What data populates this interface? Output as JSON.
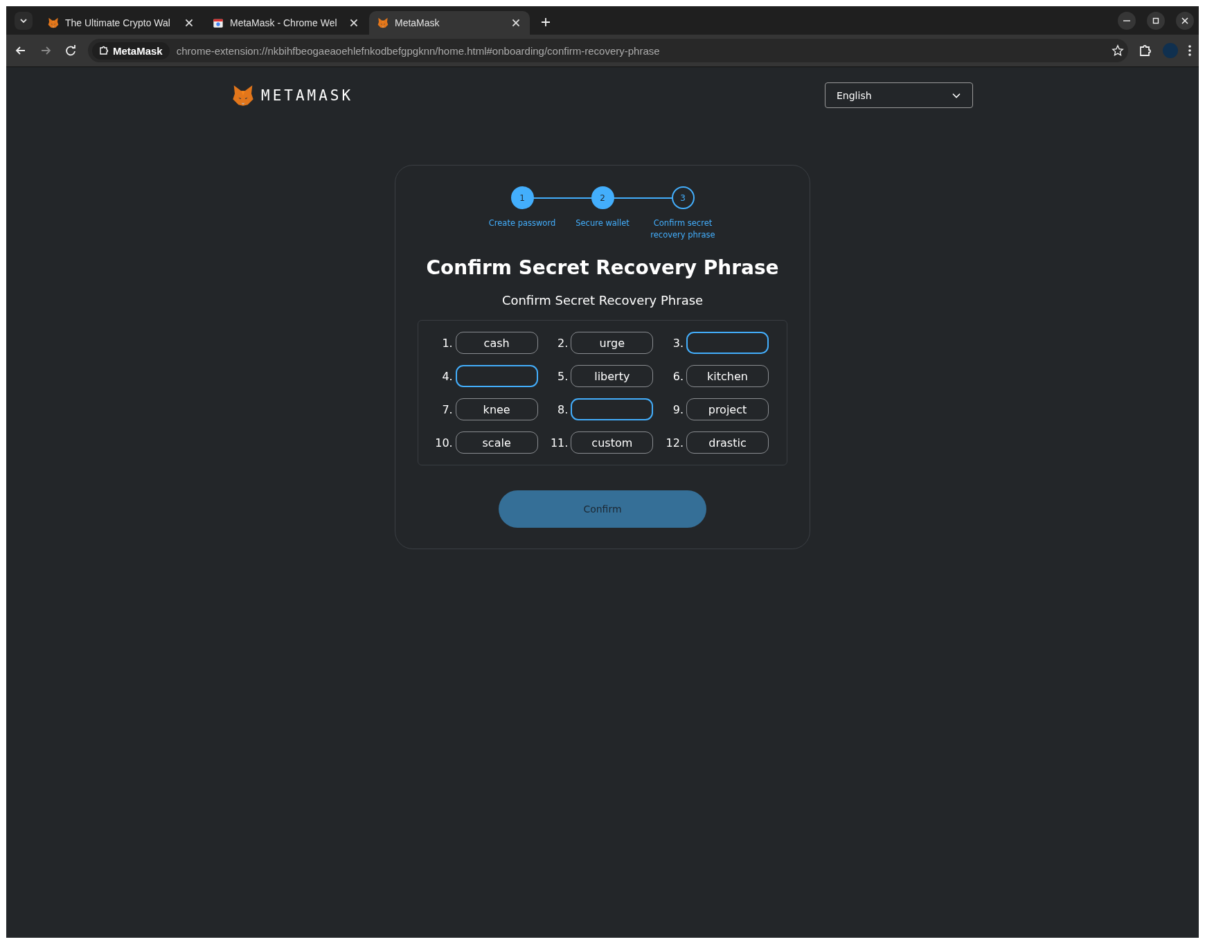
{
  "browser": {
    "tabs": [
      {
        "title": "The Ultimate Crypto Wal",
        "selected": false,
        "kind": "fox"
      },
      {
        "title": "MetaMask - Chrome Wel",
        "selected": false,
        "kind": "store"
      },
      {
        "title": "MetaMask",
        "selected": true,
        "kind": "fox"
      }
    ],
    "site_name": "MetaMask",
    "url": "chrome-extension://nkbihfbeogaeaoehlefnkodbefgpgknn/home.html#onboarding/confirm-recovery-phrase"
  },
  "header": {
    "brand": "METAMASK",
    "language": "English"
  },
  "stepper": [
    {
      "number": "1",
      "label": "Create password",
      "completed": true
    },
    {
      "number": "2",
      "label": "Secure wallet",
      "completed": true
    },
    {
      "number": "3",
      "label": "Confirm secret recovery phrase",
      "completed": false
    }
  ],
  "title": "Confirm Secret Recovery Phrase",
  "subtitle": "Confirm Secret Recovery Phrase",
  "words": [
    {
      "index": "1.",
      "kind": "word",
      "word": "cash"
    },
    {
      "index": "2.",
      "kind": "word",
      "word": "urge"
    },
    {
      "index": "3.",
      "kind": "input"
    },
    {
      "index": "4.",
      "kind": "input"
    },
    {
      "index": "5.",
      "kind": "word",
      "word": "liberty"
    },
    {
      "index": "6.",
      "kind": "word",
      "word": "kitchen"
    },
    {
      "index": "7.",
      "kind": "word",
      "word": "knee"
    },
    {
      "index": "8.",
      "kind": "input"
    },
    {
      "index": "9.",
      "kind": "word",
      "word": "project"
    },
    {
      "index": "10.",
      "kind": "word",
      "word": "scale"
    },
    {
      "index": "11.",
      "kind": "word",
      "word": "custom"
    },
    {
      "index": "12.",
      "kind": "word",
      "word": "drastic"
    }
  ],
  "confirm_button": {
    "label": "Confirm",
    "disabled": true
  }
}
